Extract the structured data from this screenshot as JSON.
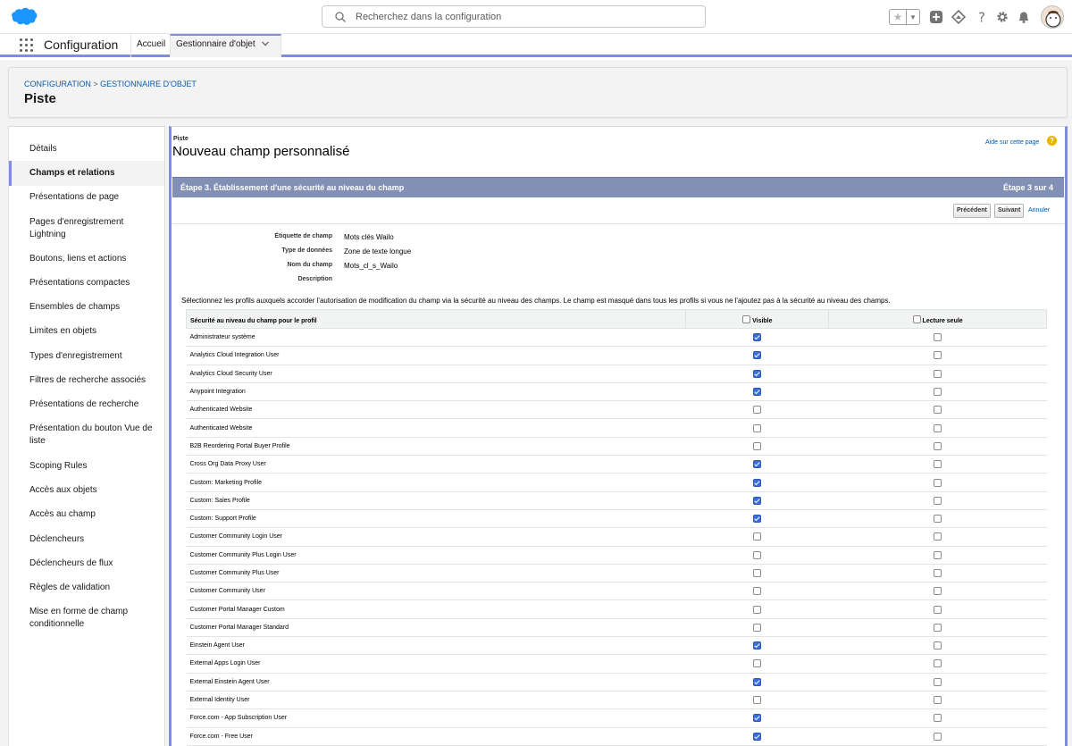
{
  "header": {
    "search_placeholder": "Recherchez dans la configuration",
    "icons": [
      "cloud-logo-icon",
      "search-icon",
      "star-icon",
      "chevron-down-icon",
      "add-icon",
      "trailhead-icon",
      "help-icon",
      "gear-icon",
      "bell-icon",
      "avatar"
    ]
  },
  "nav": {
    "app_name": "Configuration",
    "tabs": [
      {
        "label": "Accueil"
      },
      {
        "label": "Gestionnaire d'objet"
      }
    ]
  },
  "page": {
    "breadcrumb": {
      "first": "Configuration",
      "separator": ">",
      "second": "Gestionnaire d'objet"
    },
    "title": "Piste"
  },
  "sidebar": {
    "items": [
      {
        "label": "Détails"
      },
      {
        "label": "Champs et relations"
      },
      {
        "label": "Présentations de page"
      },
      {
        "label": "Pages d'enregistrement Lightning"
      },
      {
        "label": "Boutons, liens et actions"
      },
      {
        "label": "Présentations compactes"
      },
      {
        "label": "Ensembles de champs"
      },
      {
        "label": "Limites en objets"
      },
      {
        "label": "Types d'enregistrement"
      },
      {
        "label": "Filtres de recherche associés"
      },
      {
        "label": "Présentations de recherche"
      },
      {
        "label": "Présentation du bouton Vue de liste"
      },
      {
        "label": "Scoping Rules"
      },
      {
        "label": "Accès aux objets"
      },
      {
        "label": "Accès au champ"
      },
      {
        "label": "Déclencheurs"
      },
      {
        "label": "Déclencheurs de flux"
      },
      {
        "label": "Règles de validation"
      },
      {
        "label": "Mise en forme de champ conditionnelle"
      }
    ],
    "active_index": 1
  },
  "content": {
    "object_label": "Piste",
    "title": "Nouveau champ personnalisé",
    "help_link": "Aide sur cette page",
    "step_title": "Étape 3. Établissement d'une sécurité au niveau du champ",
    "step_count": "Étape 3 sur 4",
    "buttons": {
      "previous": "Précédent",
      "next": "Suivant",
      "cancel": "Annuler"
    },
    "details": [
      {
        "label": "Étiquette de champ",
        "value": "Mots clés Wailo"
      },
      {
        "label": "Type de données",
        "value": "Zone de texte longue"
      },
      {
        "label": "Nom du champ",
        "value": "Mots_cl_s_Wailo"
      },
      {
        "label": "Description",
        "value": ""
      }
    ],
    "instructions": "Sélectionnez les profils auxquels accorder l'autorisation de modification du champ via la sécurité au niveau des champs. Le champ est masqué dans tous les profils si vous ne l'ajoutez pas à la sécurité au niveau des champs.",
    "table": {
      "headers": {
        "profile": "Sécurité au niveau du champ pour le profil",
        "visible": "Visible",
        "readonly": "Lecture seule"
      },
      "rows": [
        {
          "profile": "Administrateur système",
          "visible": true,
          "readonly": false
        },
        {
          "profile": "Analytics Cloud Integration User",
          "visible": true,
          "readonly": false
        },
        {
          "profile": "Analytics Cloud Security User",
          "visible": true,
          "readonly": false
        },
        {
          "profile": "Anypoint Integration",
          "visible": true,
          "readonly": false
        },
        {
          "profile": "Authenticated Website",
          "visible": false,
          "readonly": false
        },
        {
          "profile": "Authenticated Website",
          "visible": false,
          "readonly": false
        },
        {
          "profile": "B2B Reordering Portal Buyer Profile",
          "visible": false,
          "readonly": false
        },
        {
          "profile": "Cross Org Data Proxy User",
          "visible": true,
          "readonly": false
        },
        {
          "profile": "Custom: Marketing Profile",
          "visible": true,
          "readonly": false
        },
        {
          "profile": "Custom: Sales Profile",
          "visible": true,
          "readonly": false
        },
        {
          "profile": "Custom: Support Profile",
          "visible": true,
          "readonly": false
        },
        {
          "profile": "Customer Community Login User",
          "visible": false,
          "readonly": false
        },
        {
          "profile": "Customer Community Plus Login User",
          "visible": false,
          "readonly": false
        },
        {
          "profile": "Customer Community Plus User",
          "visible": false,
          "readonly": false
        },
        {
          "profile": "Customer Community User",
          "visible": false,
          "readonly": false
        },
        {
          "profile": "Customer Portal Manager Custom",
          "visible": false,
          "readonly": false
        },
        {
          "profile": "Customer Portal Manager Standard",
          "visible": false,
          "readonly": false
        },
        {
          "profile": "Einstein Agent User",
          "visible": true,
          "readonly": false
        },
        {
          "profile": "External Apps Login User",
          "visible": false,
          "readonly": false
        },
        {
          "profile": "External Einstein Agent User",
          "visible": true,
          "readonly": false
        },
        {
          "profile": "External Identity User",
          "visible": false,
          "readonly": false
        },
        {
          "profile": "Force.com - App Subscription User",
          "visible": true,
          "readonly": false
        },
        {
          "profile": "Force.com - Free User",
          "visible": true,
          "readonly": false
        }
      ]
    }
  },
  "colors": {
    "accent": "#7f8ce0",
    "step_bar": "#8390b6",
    "link": "#0b5cab",
    "checkbox_on": "#3b6ed8",
    "brand_cloud": "#1b96ff"
  }
}
